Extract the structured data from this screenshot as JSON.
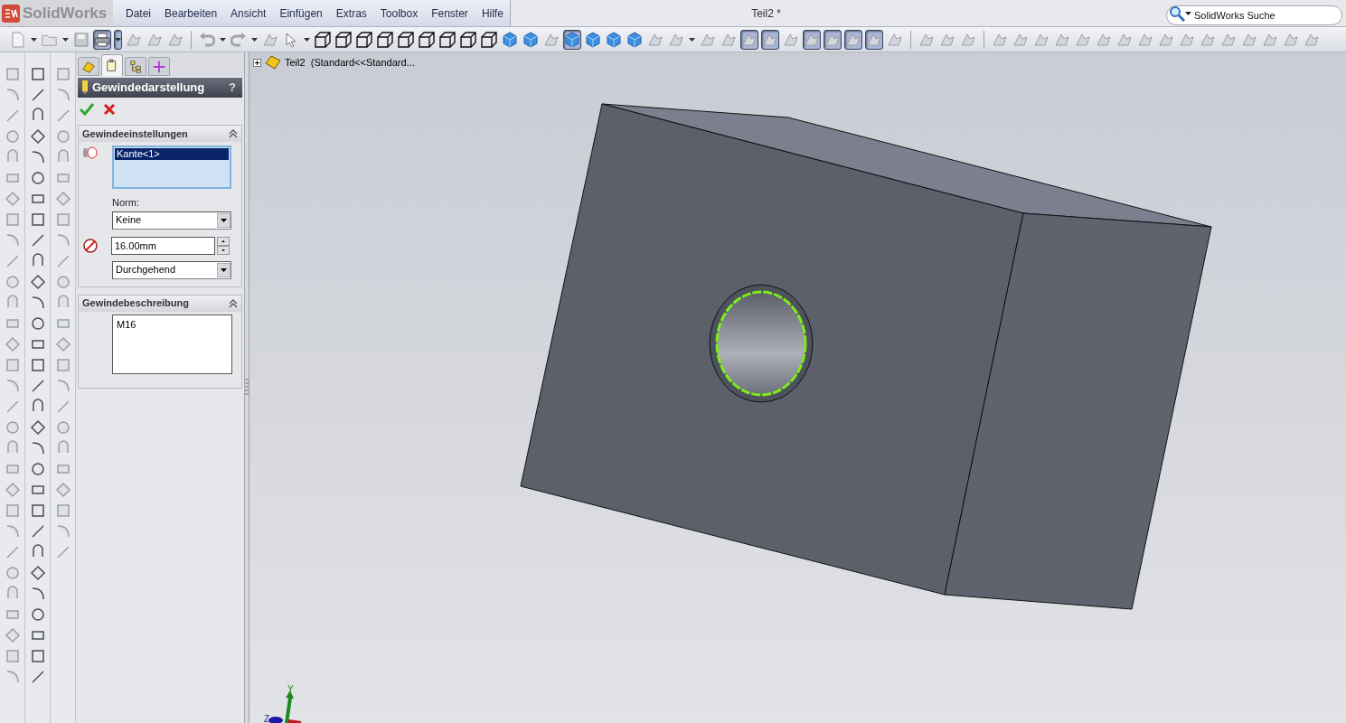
{
  "app": {
    "logo": "SolidWorks"
  },
  "menu": [
    {
      "label": "Datei"
    },
    {
      "label": "Bearbeiten"
    },
    {
      "label": "Ansicht"
    },
    {
      "label": "Einfügen"
    },
    {
      "label": "Extras"
    },
    {
      "label": "Toolbox"
    },
    {
      "label": "Fenster"
    },
    {
      "label": "Hilfe"
    }
  ],
  "window": {
    "title": "Teil2 *"
  },
  "search": {
    "placeholder": "SolidWorks Suche"
  },
  "toolbar": [
    {
      "kind": "doc",
      "selected": false
    },
    {
      "kind": "caret",
      "selected": false
    },
    {
      "kind": "open",
      "selected": false
    },
    {
      "kind": "caret",
      "selected": false
    },
    {
      "kind": "save",
      "selected": false
    },
    {
      "kind": "print",
      "selected": true
    },
    {
      "kind": "caret",
      "selected": true
    },
    {
      "kind": "tool",
      "selected": false
    },
    {
      "kind": "tool",
      "selected": false
    },
    {
      "kind": "tool",
      "selected": false
    },
    {
      "kind": "sep"
    },
    {
      "kind": "undo",
      "selected": false
    },
    {
      "kind": "caret",
      "selected": false
    },
    {
      "kind": "redo",
      "selected": false
    },
    {
      "kind": "caret",
      "selected": false
    },
    {
      "kind": "tool",
      "selected": false
    },
    {
      "kind": "pointer",
      "selected": false
    },
    {
      "kind": "caret",
      "selected": false
    },
    {
      "kind": "cube",
      "selected": false
    },
    {
      "kind": "cube",
      "selected": false
    },
    {
      "kind": "cube",
      "selected": false
    },
    {
      "kind": "cube",
      "selected": false
    },
    {
      "kind": "cube",
      "selected": false
    },
    {
      "kind": "cube",
      "selected": false
    },
    {
      "kind": "cube",
      "selected": false
    },
    {
      "kind": "cube",
      "selected": false
    },
    {
      "kind": "cube",
      "selected": false
    },
    {
      "kind": "solid",
      "selected": false
    },
    {
      "kind": "solid",
      "selected": false
    },
    {
      "kind": "tool",
      "selected": false
    },
    {
      "kind": "solid",
      "selected": true
    },
    {
      "kind": "solid",
      "selected": false
    },
    {
      "kind": "solid",
      "selected": false
    },
    {
      "kind": "solid",
      "selected": false
    },
    {
      "kind": "tool",
      "selected": false
    },
    {
      "kind": "tool",
      "selected": false
    },
    {
      "kind": "caret",
      "selected": false
    },
    {
      "kind": "tool",
      "selected": false
    },
    {
      "kind": "tool",
      "selected": false
    },
    {
      "kind": "tool",
      "selected": true
    },
    {
      "kind": "tool",
      "selected": true
    },
    {
      "kind": "tool",
      "selected": false
    },
    {
      "kind": "tool",
      "selected": true
    },
    {
      "kind": "tool",
      "selected": true
    },
    {
      "kind": "tool",
      "selected": true
    },
    {
      "kind": "tool",
      "selected": true
    },
    {
      "kind": "tool",
      "selected": false
    },
    {
      "kind": "sep"
    },
    {
      "kind": "tool",
      "selected": false
    },
    {
      "kind": "tool",
      "selected": false
    },
    {
      "kind": "tool",
      "selected": false
    },
    {
      "kind": "sep"
    },
    {
      "kind": "tool",
      "selected": false
    },
    {
      "kind": "tool",
      "selected": false
    },
    {
      "kind": "tool",
      "selected": false
    },
    {
      "kind": "tool",
      "selected": false
    },
    {
      "kind": "tool",
      "selected": false
    },
    {
      "kind": "tool",
      "selected": false
    },
    {
      "kind": "tool",
      "selected": false
    },
    {
      "kind": "tool",
      "selected": false
    },
    {
      "kind": "tool",
      "selected": false
    },
    {
      "kind": "tool",
      "selected": false
    },
    {
      "kind": "tool",
      "selected": false
    },
    {
      "kind": "tool",
      "selected": false
    },
    {
      "kind": "tool",
      "selected": false
    },
    {
      "kind": "tool",
      "selected": false
    },
    {
      "kind": "tool",
      "selected": false
    },
    {
      "kind": "tool",
      "selected": false
    }
  ],
  "panel": {
    "tabs": [
      {
        "selected": false
      },
      {
        "selected": true
      },
      {
        "selected": false
      },
      {
        "selected": false
      }
    ],
    "title": "Gewindedarstellung",
    "help": "?",
    "groups": [
      {
        "title": "Gewindeeinstellungen",
        "expanded": true,
        "selection": [
          {
            "label": "Kante<1>",
            "selected": true
          }
        ],
        "norm_label": "Norm:",
        "norm": "Keine",
        "diameter": "16.00mm",
        "end_condition": "Durchgehend"
      },
      {
        "title": "Gewindebeschreibung",
        "expanded": true,
        "description": "M16"
      }
    ]
  },
  "tree": {
    "label": "Teil2  (Standard<<Standard...",
    "expanded": false
  },
  "triad": {
    "y_label": "Y",
    "z_label": "Z"
  }
}
